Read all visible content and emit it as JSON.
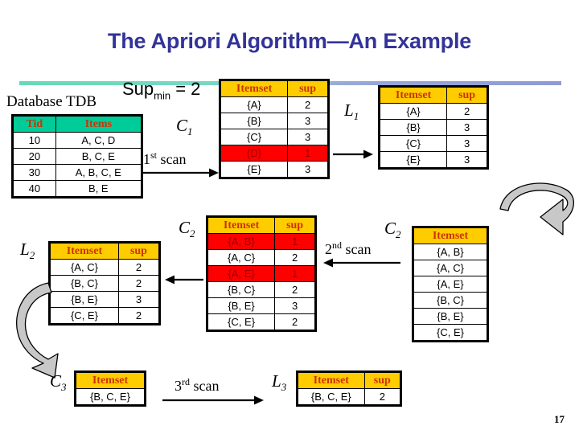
{
  "slide": {
    "title": "The Apriori Algorithm—An Example",
    "page_number": "17",
    "title_color": "#333399",
    "header_yellow": "#ffcc00",
    "header_green": "#00cc99",
    "highlight_red": "#ff0000",
    "rule_gradient_from": "#66d9b8",
    "rule_gradient_to": "#8f9ad6"
  },
  "supmin": {
    "prefix": "Sup",
    "subscript": "min",
    "suffix": " = 2"
  },
  "database": {
    "caption": "Database TDB",
    "headers": [
      "Tid",
      "Items"
    ],
    "rows": [
      [
        "10",
        "A, C, D"
      ],
      [
        "20",
        "B, C, E"
      ],
      [
        "30",
        "A, B, C, E"
      ],
      [
        "40",
        "B, E"
      ]
    ]
  },
  "scans": {
    "first": {
      "ordinal": "1",
      "suffix": "st",
      "word": " scan"
    },
    "second": {
      "ordinal": "2",
      "suffix": "nd",
      "word": " scan"
    },
    "third": {
      "ordinal": "3",
      "suffix": "rd",
      "word": " scan"
    }
  },
  "labels": {
    "c1": "C",
    "c1_sub": "1",
    "l1": "L",
    "l1_sub": "1",
    "c2_left": "C",
    "c2_left_sub": "2",
    "c2_right": "C",
    "c2_right_sub": "2",
    "l2": "L",
    "l2_sub": "2",
    "c3": "C",
    "c3_sub": "3",
    "l3": "L",
    "l3_sub": "3"
  },
  "c1_table": {
    "headers": [
      "Itemset",
      "sup"
    ],
    "rows": [
      {
        "itemset": "{A}",
        "sup": "2",
        "pruned": false
      },
      {
        "itemset": "{B}",
        "sup": "3",
        "pruned": false
      },
      {
        "itemset": "{C}",
        "sup": "3",
        "pruned": false
      },
      {
        "itemset": "{D}",
        "sup": "1",
        "pruned": true
      },
      {
        "itemset": "{E}",
        "sup": "3",
        "pruned": false
      }
    ]
  },
  "l1_table": {
    "headers": [
      "Itemset",
      "sup"
    ],
    "rows": [
      {
        "itemset": "{A}",
        "sup": "2"
      },
      {
        "itemset": "{B}",
        "sup": "3"
      },
      {
        "itemset": "{C}",
        "sup": "3"
      },
      {
        "itemset": "{E}",
        "sup": "3"
      }
    ]
  },
  "c2_counted_table": {
    "headers": [
      "Itemset",
      "sup"
    ],
    "rows": [
      {
        "itemset": "{A, B}",
        "sup": "1",
        "pruned": true
      },
      {
        "itemset": "{A, C}",
        "sup": "2",
        "pruned": false
      },
      {
        "itemset": "{A, E}",
        "sup": "1",
        "pruned": true
      },
      {
        "itemset": "{B, C}",
        "sup": "2",
        "pruned": false
      },
      {
        "itemset": "{B, E}",
        "sup": "3",
        "pruned": false
      },
      {
        "itemset": "{C, E}",
        "sup": "2",
        "pruned": false
      }
    ]
  },
  "c2_candidate_table": {
    "headers": [
      "Itemset"
    ],
    "rows": [
      "{A, B}",
      "{A, C}",
      "{A, E}",
      "{B, C}",
      "{B, E}",
      "{C, E}"
    ]
  },
  "l2_table": {
    "headers": [
      "Itemset",
      "sup"
    ],
    "rows": [
      {
        "itemset": "{A, C}",
        "sup": "2"
      },
      {
        "itemset": "{B, C}",
        "sup": "2"
      },
      {
        "itemset": "{B, E}",
        "sup": "3"
      },
      {
        "itemset": "{C, E}",
        "sup": "2"
      }
    ]
  },
  "c3_table": {
    "headers": [
      "Itemset"
    ],
    "rows": [
      "{B, C, E}"
    ]
  },
  "l3_table": {
    "headers": [
      "Itemset",
      "sup"
    ],
    "rows": [
      {
        "itemset": "{B, C, E}",
        "sup": "2"
      }
    ]
  }
}
